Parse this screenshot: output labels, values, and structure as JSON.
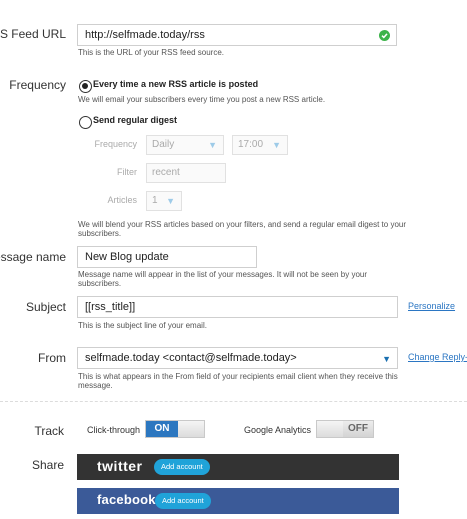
{
  "rss_feed": {
    "label": "RSS Feed URL",
    "value": "http://selfmade.today/rss",
    "status_icon": "check-circle-icon",
    "help": "This is the URL of your RSS feed source."
  },
  "frequency": {
    "label": "Frequency",
    "option_new": "Every time a new RSS article is posted",
    "option_new_help": "We will email your subscribers every time you post a new RSS article.",
    "option_digest": "Send regular digest",
    "selected": "option_new",
    "digest": {
      "frequency_label": "Frequency",
      "frequency_value": "Daily",
      "time_value": "17:00",
      "filter_label": "Filter",
      "filter_value": "recent",
      "articles_label": "Articles",
      "articles_value": "1"
    },
    "digest_help": "We will blend your RSS articles based on your filters, and send a regular email digest to your subscribers."
  },
  "message_name": {
    "label": "essage name",
    "value": "New Blog update",
    "help": "Message name will appear in the list of your messages. It will not be seen by your subscribers."
  },
  "subject": {
    "label": "Subject",
    "value": "[[rss_title]]",
    "personalize": "Personalize",
    "help": "This is the subject line of your email."
  },
  "from": {
    "label": "From",
    "value": "selfmade.today <contact@selfmade.today>",
    "change_link": "Change Reply-To",
    "help": "This is what appears in the From field of your recipients email client when they receive this message."
  },
  "track": {
    "label": "Track",
    "clickthrough_label": "Click-through",
    "clickthrough_state": "ON",
    "ga_label": "Google Analytics",
    "ga_state": "OFF"
  },
  "share": {
    "label": "Share",
    "twitter_brand": "twitter",
    "twitter_add": "Add account",
    "facebook_brand": "facebook",
    "facebook_add": "Add account"
  },
  "colors": {
    "twitter_bg": "#333333",
    "facebook_bg": "#3b5a98",
    "accent": "#2c77c0",
    "link": "#2b76c3",
    "check": "#3cb34a"
  }
}
